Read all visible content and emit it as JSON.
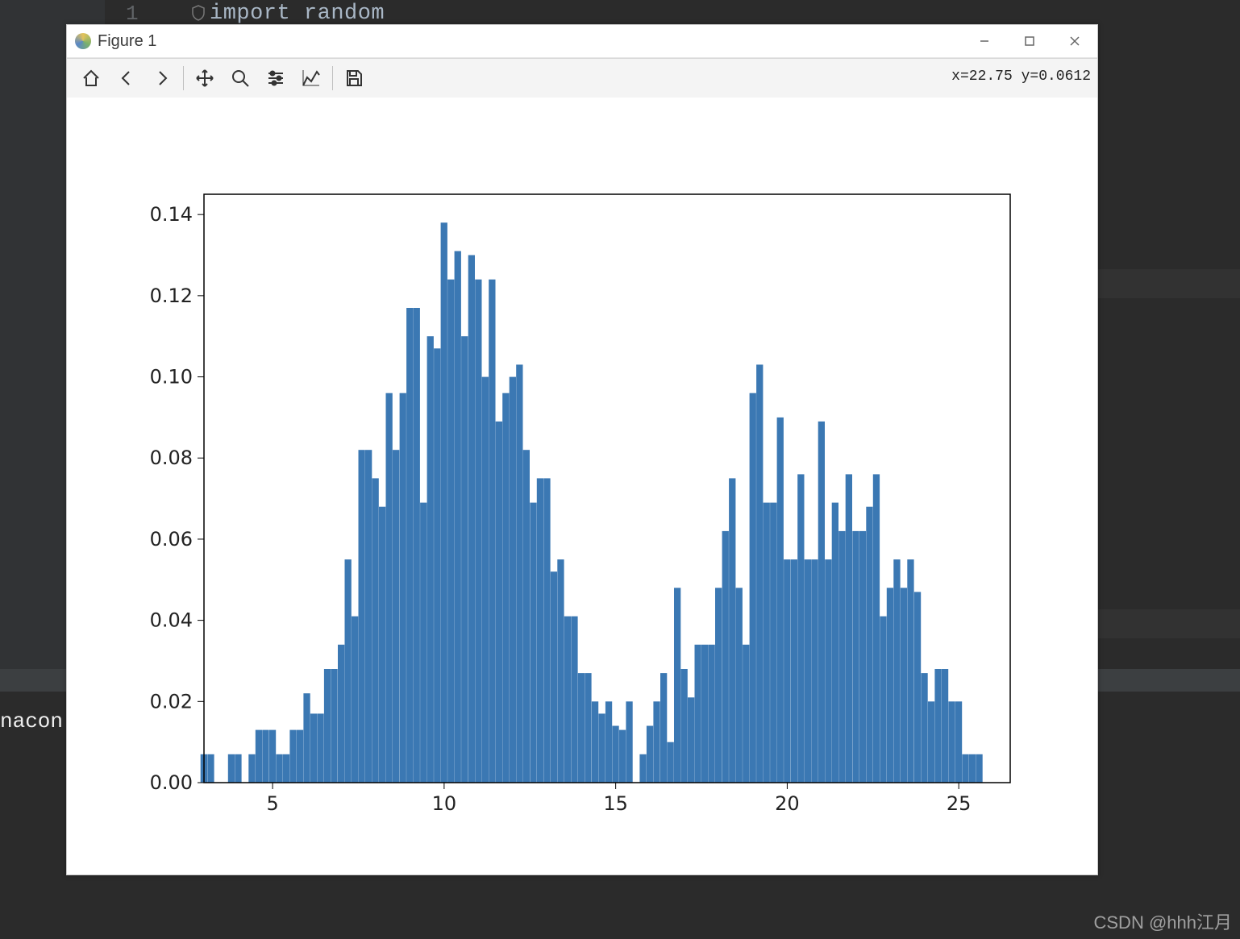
{
  "editor": {
    "line_number": "1",
    "code_line": "import random",
    "run_prefix": "nacon"
  },
  "watermark": "CSDN @hhh江月",
  "figure_window": {
    "title": "Figure 1",
    "coord_readout": "x=22.75 y=0.0612",
    "toolbar": {
      "home": "Home",
      "back": "Back",
      "forward": "Forward",
      "pan": "Pan",
      "zoom": "Zoom",
      "subplots": "Configure subplots",
      "axes": "Edit axis",
      "save": "Save"
    }
  },
  "chart_data": {
    "type": "bar",
    "title": "",
    "xlabel": "",
    "ylabel": "",
    "xlim": [
      3.0,
      26.5
    ],
    "ylim": [
      0.0,
      0.145
    ],
    "x_ticks": [
      5,
      10,
      15,
      20,
      25
    ],
    "y_ticks": [
      0.0,
      0.02,
      0.04,
      0.06,
      0.08,
      0.1,
      0.12,
      0.14
    ],
    "categories": [
      3.0,
      3.2,
      3.4,
      3.6,
      3.8,
      4.0,
      4.2,
      4.4,
      4.6,
      4.8,
      5.0,
      5.2,
      5.4,
      5.6,
      5.8,
      6.0,
      6.2,
      6.4,
      6.6,
      6.8,
      7.0,
      7.2,
      7.4,
      7.6,
      7.8,
      8.0,
      8.2,
      8.4,
      8.6,
      8.8,
      9.0,
      9.2,
      9.4,
      9.6,
      9.8,
      10.0,
      10.2,
      10.4,
      10.6,
      10.8,
      11.0,
      11.2,
      11.4,
      11.6,
      11.8,
      12.0,
      12.2,
      12.4,
      12.6,
      12.8,
      13.0,
      13.2,
      13.4,
      13.6,
      13.8,
      14.0,
      14.2,
      14.4,
      14.6,
      14.8,
      15.0,
      15.2,
      15.4,
      15.6,
      15.8,
      16.0,
      16.2,
      16.4,
      16.6,
      16.8,
      17.0,
      17.2,
      17.4,
      17.6,
      17.8,
      18.0,
      18.2,
      18.4,
      18.6,
      18.8,
      19.0,
      19.2,
      19.4,
      19.6,
      19.8,
      20.0,
      20.2,
      20.4,
      20.6,
      20.8,
      21.0,
      21.2,
      21.4,
      21.6,
      21.8,
      22.0,
      22.2,
      22.4,
      22.6,
      22.8,
      23.0,
      23.2,
      23.4,
      23.6,
      23.8,
      24.0,
      24.2,
      24.4,
      24.6,
      24.8,
      25.0,
      25.2,
      25.4,
      25.6
    ],
    "values": [
      0.007,
      0.007,
      0.0,
      0.0,
      0.007,
      0.007,
      0.0,
      0.007,
      0.013,
      0.013,
      0.013,
      0.007,
      0.007,
      0.013,
      0.013,
      0.022,
      0.017,
      0.017,
      0.028,
      0.028,
      0.034,
      0.055,
      0.041,
      0.082,
      0.082,
      0.075,
      0.068,
      0.096,
      0.082,
      0.096,
      0.117,
      0.117,
      0.069,
      0.11,
      0.107,
      0.138,
      0.124,
      0.131,
      0.11,
      0.13,
      0.124,
      0.1,
      0.124,
      0.089,
      0.096,
      0.1,
      0.103,
      0.082,
      0.069,
      0.075,
      0.075,
      0.052,
      0.055,
      0.041,
      0.041,
      0.027,
      0.027,
      0.02,
      0.017,
      0.02,
      0.014,
      0.013,
      0.02,
      0.0,
      0.007,
      0.014,
      0.02,
      0.027,
      0.01,
      0.048,
      0.028,
      0.021,
      0.034,
      0.034,
      0.034,
      0.048,
      0.062,
      0.075,
      0.048,
      0.034,
      0.096,
      0.103,
      0.069,
      0.069,
      0.09,
      0.055,
      0.055,
      0.076,
      0.055,
      0.055,
      0.089,
      0.055,
      0.069,
      0.062,
      0.076,
      0.062,
      0.062,
      0.068,
      0.076,
      0.041,
      0.048,
      0.055,
      0.048,
      0.055,
      0.047,
      0.027,
      0.02,
      0.028,
      0.028,
      0.02,
      0.02,
      0.007,
      0.007,
      0.007
    ]
  }
}
